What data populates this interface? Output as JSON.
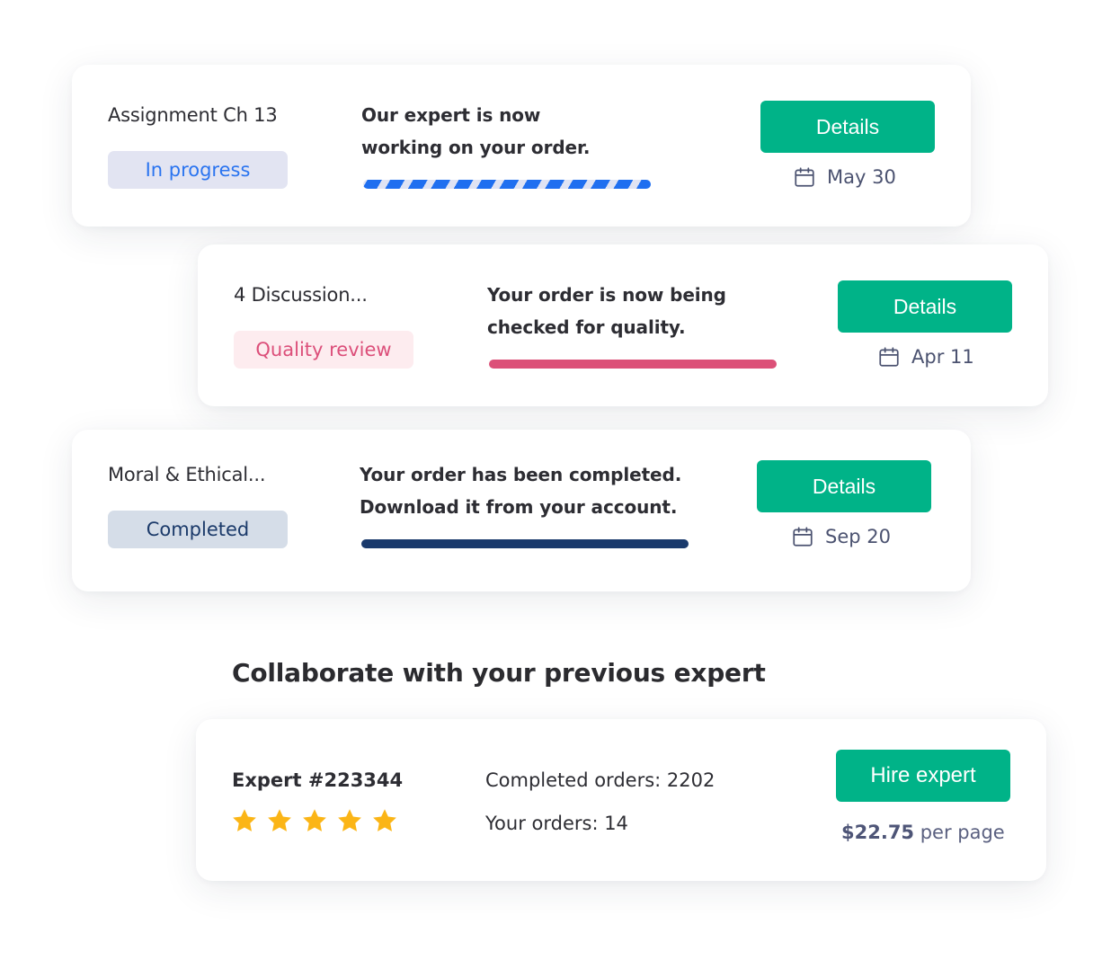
{
  "orders": [
    {
      "title": "Assignment Ch 13",
      "status": "In progress",
      "message_line1": "Our expert  is now",
      "message_line2": "working on your order.",
      "progress_style": "striped",
      "button_label": "Details",
      "date": "May 30",
      "colors": {
        "badge_bg": "#e2e4f2",
        "badge_text": "#2a74f0",
        "bar": "#1f6ff0"
      }
    },
    {
      "title": "4 Discussion...",
      "status": "Quality review",
      "message_line1": "Your order is now being",
      "message_line2": "checked for quality.",
      "progress_style": "solid",
      "button_label": "Details",
      "date": "Apr 11",
      "colors": {
        "badge_bg": "#fdecef",
        "badge_text": "#dc4f7a",
        "bar": "#dc5078"
      }
    },
    {
      "title": "Moral & Ethical...",
      "status": "Completed",
      "message_line1": "Your order has been completed.",
      "message_line2": "Download it from your account.",
      "progress_style": "solid",
      "button_label": "Details",
      "date": "Sep 20",
      "colors": {
        "badge_bg": "#d5dde8",
        "badge_text": "#1b3a6a",
        "bar": "#1a3a6c"
      }
    }
  ],
  "section": {
    "heading": "Collaborate with your previous expert"
  },
  "expert": {
    "name": "Expert  #223344",
    "rating": 5,
    "rating_max": 5,
    "completed_orders": "Completed orders: 2202",
    "your_orders": "Your orders: 14",
    "button_label": "Hire expert",
    "price": "$22.75",
    "price_unit": " per page"
  },
  "theme": {
    "primary_button": "#00b388",
    "star": "#fbb516",
    "date_text": "#4b5270"
  },
  "icons": {
    "date": "calendar-icon",
    "rating": "star-icon"
  }
}
